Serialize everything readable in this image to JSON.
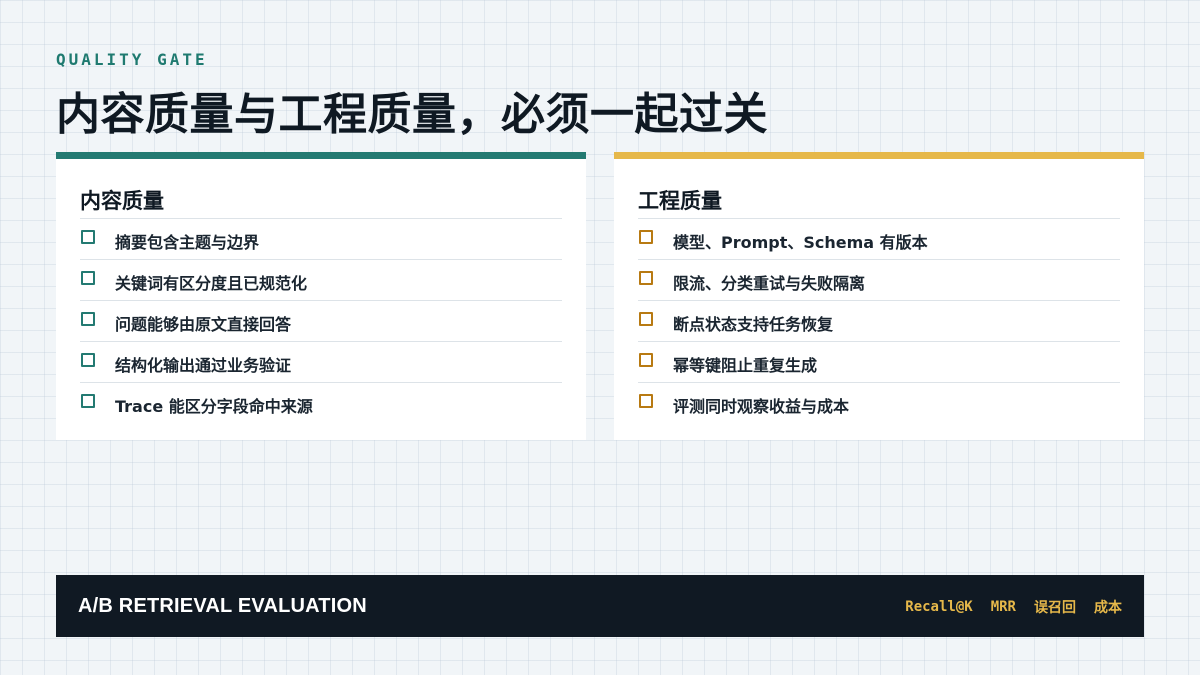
{
  "header": {
    "eyebrow": "QUALITY GATE",
    "title": "内容质量与工程质量，必须一起过关"
  },
  "content_quality": {
    "title": "内容质量",
    "accent_color": "#237a72",
    "items": [
      {
        "label": "摘要包含主题与边界"
      },
      {
        "label": "关键词有区分度且已规范化"
      },
      {
        "label": "问题能够由原文直接回答"
      },
      {
        "label": "结构化输出通过业务验证"
      },
      {
        "label": "Trace 能区分字段命中来源"
      }
    ]
  },
  "engineering_quality": {
    "title": "工程质量",
    "accent_color": "#e6b84a",
    "items": [
      {
        "label": "模型、Prompt、Schema 有版本"
      },
      {
        "label": "限流、分类重试与失败隔离"
      },
      {
        "label": "断点状态支持任务恢复"
      },
      {
        "label": "幂等键阻止重复生成"
      },
      {
        "label": "评测同时观察收益与成本"
      }
    ]
  },
  "footer": {
    "title": "A/B RETRIEVAL EVALUATION",
    "metrics": [
      "Recall@K",
      "MRR",
      "误召回",
      "成本"
    ]
  }
}
